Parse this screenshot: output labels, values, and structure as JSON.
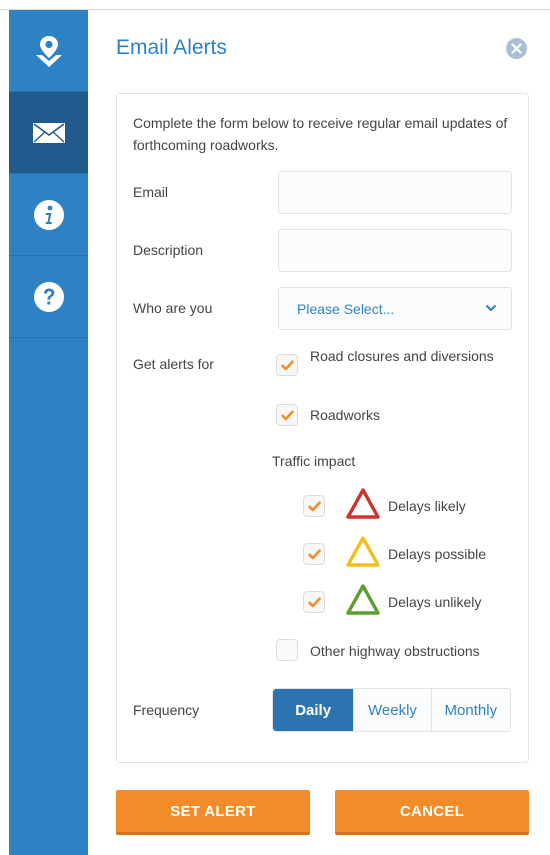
{
  "sidebar": {
    "items": [
      {
        "icon": "map-pin-icon"
      },
      {
        "icon": "envelope-icon",
        "active": true
      },
      {
        "icon": "info-icon"
      },
      {
        "icon": "help-icon"
      }
    ]
  },
  "panel": {
    "title": "Email Alerts",
    "intro": "Complete the form below to receive regular email updates of forthcoming roadworks."
  },
  "form": {
    "email_label": "Email",
    "email_value": "",
    "description_label": "Description",
    "description_value": "",
    "who_label": "Who are you",
    "who_selected": "Please Select...",
    "alerts_label": "Get alerts for",
    "alerts": {
      "road_closures": {
        "label": "Road closures and diversions",
        "checked": true
      },
      "roadworks": {
        "label": "Roadworks",
        "checked": true
      },
      "traffic_impact_label": "Traffic impact",
      "impact": [
        {
          "label": "Delays likely",
          "checked": true,
          "color": "#d0312d"
        },
        {
          "label": "Delays possible",
          "checked": true,
          "color": "#f5bf1b"
        },
        {
          "label": "Delays unlikely",
          "checked": true,
          "color": "#5e9e2f"
        }
      ],
      "other": {
        "label": "Other highway obstructions",
        "checked": false
      }
    },
    "frequency_label": "Frequency",
    "frequency_options": [
      "Daily",
      "Weekly",
      "Monthly"
    ],
    "frequency_selected": "Daily"
  },
  "actions": {
    "set_alert": "SET ALERT",
    "cancel": "CANCEL"
  },
  "colors": {
    "accent": "#2e82c4",
    "orange": "#f28c2a",
    "check": "#f28c2a"
  }
}
